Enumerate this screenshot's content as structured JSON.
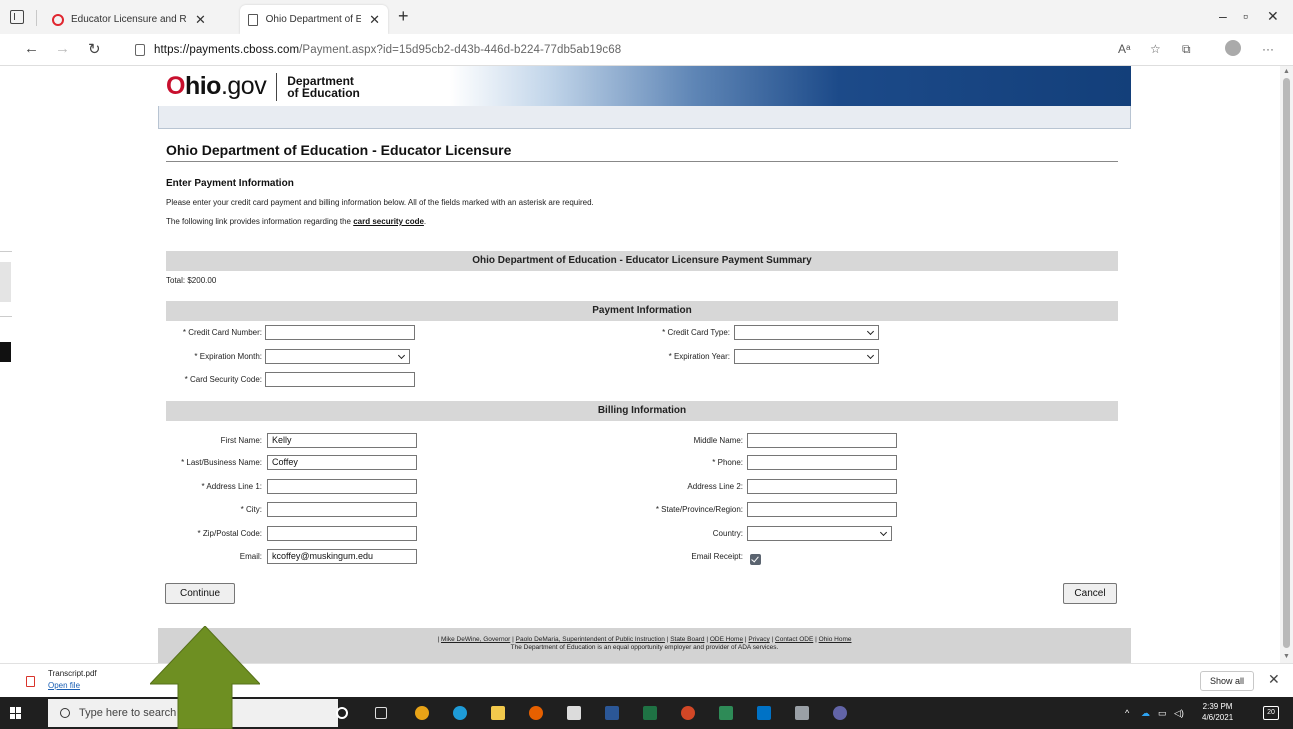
{
  "browser": {
    "tabs": [
      {
        "title": "Educator Licensure and Records",
        "favicon": "opera-icon"
      },
      {
        "title": "Ohio Department of Education -",
        "favicon": "page-icon"
      }
    ],
    "url_domain": "https://payments.cboss.com",
    "url_path": "/Payment.aspx?id=15d95cb2-d43b-446d-b224-77db5ab19c68"
  },
  "header": {
    "logo_o": "O",
    "logo_hio": "hio",
    "logo_gov": ".gov",
    "dept_line1": "Department",
    "dept_line2": "of Education"
  },
  "page": {
    "title": "Ohio Department of Education - Educator Licensure",
    "section_heading": "Enter Payment Information",
    "instructions": "Please enter your credit card payment and billing information below. All of the fields marked with an asterisk are required.",
    "link_intro": "The following link provides information regarding the ",
    "link_text": "card security code",
    "link_end": "."
  },
  "summary": {
    "heading": "Ohio Department of Education - Educator Licensure Payment Summary",
    "total": "Total:  $200.00"
  },
  "payment": {
    "heading": "Payment Information",
    "card_number_label": "* Credit Card Number:",
    "card_number_value": "",
    "card_type_label": "* Credit Card Type:",
    "card_type_value": "",
    "exp_month_label": "* Expiration Month:",
    "exp_month_value": "",
    "exp_year_label": "* Expiration Year:",
    "exp_year_value": "",
    "security_code_label": "* Card Security Code:",
    "security_code_value": ""
  },
  "billing": {
    "heading": "Billing Information",
    "first_name_label": "First Name:",
    "first_name_value": "Kelly",
    "middle_name_label": "Middle Name:",
    "middle_name_value": "",
    "last_name_label": "* Last/Business Name:",
    "last_name_value": "Coffey",
    "phone_label": "* Phone:",
    "phone_value": "",
    "address1_label": "* Address Line 1:",
    "address1_value": "",
    "address2_label": "Address Line 2:",
    "address2_value": "",
    "city_label": "* City:",
    "city_value": "",
    "state_label": "* State/Province/Region:",
    "state_value": "",
    "zip_label": "* Zip/Postal Code:",
    "zip_value": "",
    "country_label": "Country:",
    "country_value": "",
    "email_label": "Email:",
    "email_value": "kcoffey@muskingum.edu",
    "email_receipt_label": "Email Receipt:",
    "email_receipt_checked": true
  },
  "buttons": {
    "continue": "Continue",
    "cancel": "Cancel"
  },
  "footer": {
    "links": [
      "Mike DeWine, Governor",
      "Paolo DeMaria, Superintendent of Public Instruction",
      "State Board",
      "ODE Home",
      "Privacy",
      "Contact ODE",
      "Ohio Home"
    ],
    "tagline": "The Department of Education is an equal opportunity employer and provider of ADA services."
  },
  "downloads": {
    "file_name": "Transcript.pdf",
    "open_label": "Open file",
    "show_all": "Show all"
  },
  "taskbar": {
    "search_placeholder": "Type here to search",
    "time": "2:39 PM",
    "date": "4/6/2021",
    "notification_count": "20"
  },
  "colors": {
    "banner_navy": "#133f7a",
    "logo_red": "#c8102e",
    "arrow_green": "#6e8f22",
    "section_gray": "#d7d7d7"
  }
}
